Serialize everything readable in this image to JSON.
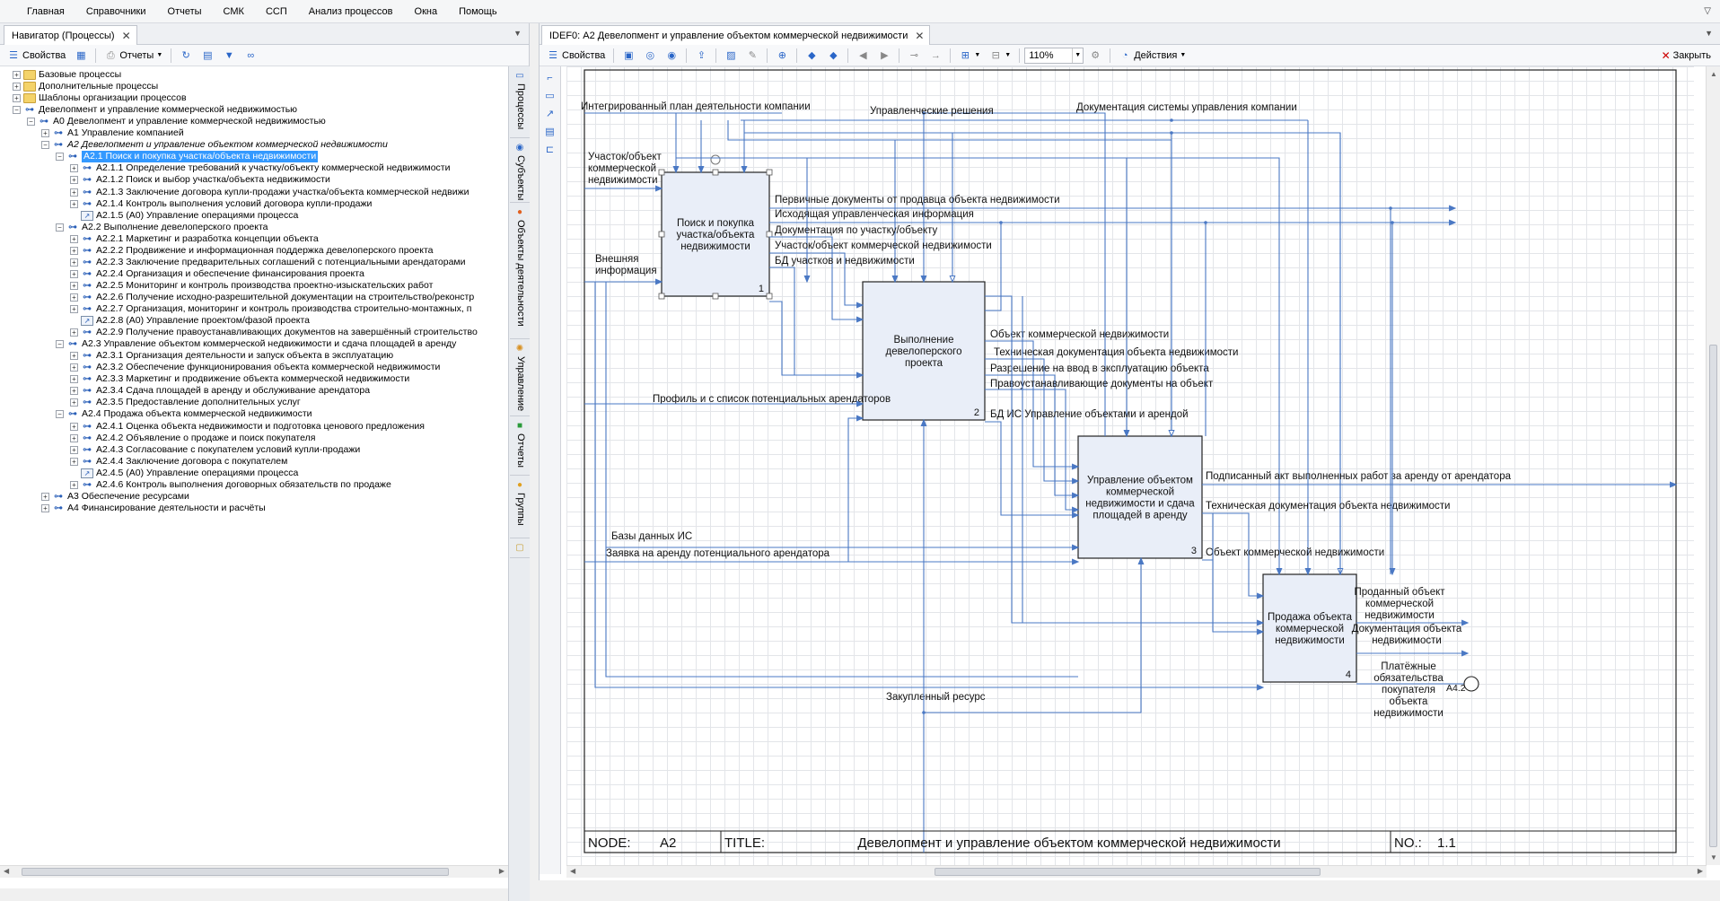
{
  "menu": [
    "Главная",
    "Справочники",
    "Отчеты",
    "СМК",
    "ССП",
    "Анализ процессов",
    "Окна",
    "Помощь"
  ],
  "menu_corner": "▽",
  "navigator": {
    "tab_title": "Навигатор (Процессы)",
    "toolbar": {
      "properties": "Свойства",
      "reports": "Отчеты"
    },
    "tree": [
      {
        "label": "Базовые процессы",
        "level": 0,
        "icon": "folder",
        "exp": "+"
      },
      {
        "label": "Дополнительные процессы",
        "level": 0,
        "icon": "folder",
        "exp": "+"
      },
      {
        "label": "Шаблоны организации процессов",
        "level": 0,
        "icon": "folder",
        "exp": "+"
      },
      {
        "label": "Девелопмент и управление  коммерческой недвижимостью",
        "level": 0,
        "icon": "proc",
        "exp": "−"
      },
      {
        "label": "А0 Девелопмент и управление коммерческой недвижимостью",
        "level": 1,
        "icon": "proc",
        "exp": "−"
      },
      {
        "label": "А1 Управление компанией",
        "level": 2,
        "icon": "proc",
        "exp": "+"
      },
      {
        "label": "А2 Девелопмент и управление объектом коммерческой недвижимости",
        "level": 2,
        "icon": "proc",
        "exp": "−",
        "italic": true
      },
      {
        "label": "А2.1 Поиск и покупка участка/объекта недвижимости",
        "level": 3,
        "icon": "proc",
        "exp": "−",
        "selected": true
      },
      {
        "label": "А2.1.1 Определение требований к участку/объекту коммерческой недвижимости",
        "level": 4,
        "icon": "proc",
        "exp": "+"
      },
      {
        "label": "А2.1.2 Поиск и выбор участка/объекта недвижимости",
        "level": 4,
        "icon": "proc",
        "exp": "+"
      },
      {
        "label": "А2.1.3 Заключение договора купли-продажи участка/объекта коммерческой недвижи",
        "level": 4,
        "icon": "proc",
        "exp": "+"
      },
      {
        "label": "А2.1.4 Контроль выполнения условий договора купли-продажи",
        "level": 4,
        "icon": "proc",
        "exp": "+"
      },
      {
        "label": "А2.1.5 (А0) Управление операциями процесса",
        "level": 4,
        "icon": "link",
        "exp": ""
      },
      {
        "label": "А2.2 Выполнение девелоперского проекта",
        "level": 3,
        "icon": "proc",
        "exp": "−"
      },
      {
        "label": "А2.2.1 Маркетинг и разработка концепции объекта",
        "level": 4,
        "icon": "proc",
        "exp": "+"
      },
      {
        "label": "А2.2.2 Продвижение и информационная поддержка девелоперского проекта",
        "level": 4,
        "icon": "proc",
        "exp": "+"
      },
      {
        "label": "А2.2.3 Заключение предварительных соглашений с потенциальными арендаторами",
        "level": 4,
        "icon": "proc",
        "exp": "+"
      },
      {
        "label": "А2.2.4 Организация и обеспечение финансирования проекта",
        "level": 4,
        "icon": "proc",
        "exp": "+"
      },
      {
        "label": "А2.2.5 Мониторинг и контроль производства проектно-изыскательских работ",
        "level": 4,
        "icon": "proc",
        "exp": "+"
      },
      {
        "label": "А2.2.6 Получение исходно-разрешительной документации на строительство/реконстр",
        "level": 4,
        "icon": "proc",
        "exp": "+"
      },
      {
        "label": "А2.2.7 Организация, мониторинг и контроль производства строительно-монтажных, п",
        "level": 4,
        "icon": "proc",
        "exp": "+"
      },
      {
        "label": "А2.2.8 (А0) Управление проектом/фазой проекта",
        "level": 4,
        "icon": "link",
        "exp": ""
      },
      {
        "label": "А2.2.9 Получение правоустанавливающих документов на завершённый строительство",
        "level": 4,
        "icon": "proc",
        "exp": "+"
      },
      {
        "label": "А2.3 Управление объектом коммерческой недвижимости и сдача площадей в аренду",
        "level": 3,
        "icon": "proc",
        "exp": "−"
      },
      {
        "label": "А2.3.1 Организация деятельности и запуск объекта в эксплуатацию",
        "level": 4,
        "icon": "proc",
        "exp": "+"
      },
      {
        "label": "А2.3.2 Обеспечение функционирования объекта коммерческой недвижимости",
        "level": 4,
        "icon": "proc",
        "exp": "+"
      },
      {
        "label": "А2.3.3 Маркетинг и продвижение объекта коммерческой недвижимости",
        "level": 4,
        "icon": "proc",
        "exp": "+"
      },
      {
        "label": "А2.3.4 Сдача площадей в аренду и обслуживание арендатора",
        "level": 4,
        "icon": "proc",
        "exp": "+"
      },
      {
        "label": "А2.3.5 Предоставление дополнительных услуг",
        "level": 4,
        "icon": "proc",
        "exp": "+"
      },
      {
        "label": "А2.4 Продажа объекта коммерческой недвижимости",
        "level": 3,
        "icon": "proc",
        "exp": "−"
      },
      {
        "label": "А2.4.1 Оценка объекта недвижимости и подготовка ценового предложения",
        "level": 4,
        "icon": "proc",
        "exp": "+"
      },
      {
        "label": "А2.4.2 Объявление о продаже и поиск покупателя",
        "level": 4,
        "icon": "proc",
        "exp": "+"
      },
      {
        "label": "А2.4.3 Согласование с покупателем условий купли-продажи",
        "level": 4,
        "icon": "proc",
        "exp": "+"
      },
      {
        "label": "А2.4.4 Заключение договора с покупателем",
        "level": 4,
        "icon": "proc",
        "exp": "+"
      },
      {
        "label": "А2.4.5 (А0) Управление операциями процесса",
        "level": 4,
        "icon": "link",
        "exp": ""
      },
      {
        "label": "А2.4.6 Контроль выполнения договорных обязательств по продаже",
        "level": 4,
        "icon": "proc",
        "exp": "+"
      },
      {
        "label": "А3 Обеспечение ресурсами",
        "level": 2,
        "icon": "proc",
        "exp": "+"
      },
      {
        "label": "А4 Финансирование деятельности и расчёты",
        "level": 2,
        "icon": "proc",
        "exp": "+"
      }
    ],
    "side_tabs": [
      "Процессы",
      "Субъекты",
      "Объекты деятельности",
      "Управление",
      "Отчеты",
      "Группы"
    ]
  },
  "editor": {
    "tab_title": "IDEF0: А2 Девелопмент и управление объектом коммерческой недвижимости",
    "toolbar": {
      "properties": "Свойства",
      "zoom": "110%",
      "actions": "Действия",
      "close": "Закрыть"
    },
    "diagram": {
      "boxes": [
        {
          "title": "Поиск и покупка участка/объекта недвижимости",
          "num": "1"
        },
        {
          "title": "Выполнение девелоперского проекта",
          "num": "2"
        },
        {
          "title": "Управление объектом коммерческой недвижимости и сдача площадей в аренду",
          "num": "3"
        },
        {
          "title": "Продажа объекта коммерческой недвижимости",
          "num": "4"
        }
      ],
      "labels": {
        "plan": "Интегрированный план деятельности компании",
        "decisions": "Управленческие решения",
        "docs_system": "Документация системы управления компании",
        "input1": "Участок/объект коммерческой недвижимости",
        "ext_info": "Внешняя информация",
        "prim_docs": "Первичные документы от продавца объекта недвижимости",
        "out_mgmt": "Исходящая управленческая информация",
        "doc_plot": "Документация по участку/объекту",
        "plot_obj": "Участок/объект коммерческой недвижимости",
        "db_plots": "БД участков и недвижимости",
        "tenants": "Профиль и с список потенциальных арендаторов",
        "obj": "Объект коммерческой недвижимости",
        "tech_docs": "Техническая документация объекта недвижимости",
        "permit": "Разрешение на ввод в эксплуатацию объекта",
        "title_docs": "Правоустанавливающие документы на объект",
        "db_is": "БД ИС Управление объектами и арендой",
        "act": "Подписанный акт выполненных работ за аренду от арендатора",
        "tech_docs2": "Техническая документация объекта недвижимости",
        "obj2": "Объект коммерческой недвижимости",
        "dbs": "Базы данных ИС",
        "request": "Заявка на аренду потенциального арендатора",
        "sold": "Проданный объект коммерческой недвижимости",
        "sale_docs": "Документация объекта недвижимости",
        "payment": "Платёжные обязательства покупателя объекта недвижимости",
        "resource": "Закупленный ресурс",
        "ref": "А4.2"
      },
      "footer": {
        "node_label": "NODE:",
        "node": "А2",
        "title_label": "TITLE:",
        "title": "Девелопмент и управление объектом коммерческой недвижимости",
        "no_label": "NO.:",
        "no": "1.1"
      }
    }
  }
}
